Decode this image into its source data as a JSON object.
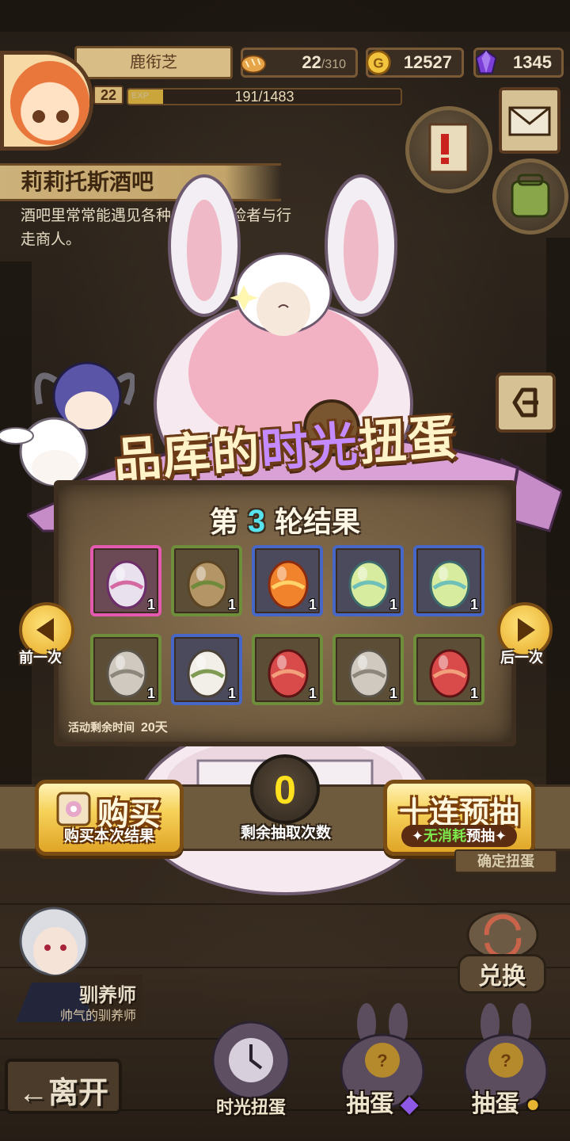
{
  "player": {
    "name": "鹿衔芝",
    "level": "22",
    "exp_label": "EXP",
    "exp_text": "191/1483",
    "exp_fraction": 0.1288
  },
  "resources": {
    "stamina": "22",
    "stamina_max": "/310",
    "gold": "12527",
    "gems": "1345"
  },
  "location": {
    "title": "莉莉托斯酒吧",
    "description": "酒吧里常常能遇见各种各样的冒险者与行走商人。"
  },
  "banner": {
    "title_a": "品库的",
    "title_b": "时光",
    "title_c": "扭蛋"
  },
  "results": {
    "round_prefix": "第",
    "round_number": "3",
    "round_suffix": "轮结果",
    "remaining_time_label": "活动剩余时间",
    "remaining_time_value": "20天",
    "items": [
      {
        "icon": "dark-spider-egg-icon",
        "rarity": "pink",
        "qty": "1"
      },
      {
        "icon": "leaf-wrapped-egg-icon",
        "rarity": "green",
        "qty": "1"
      },
      {
        "icon": "flame-egg-icon",
        "rarity": "blue",
        "qty": "1"
      },
      {
        "icon": "serpent-egg-icon",
        "rarity": "blue",
        "qty": "1"
      },
      {
        "icon": "serpent-egg-icon",
        "rarity": "blue",
        "qty": "1"
      },
      {
        "icon": "grey-shell-egg-icon",
        "rarity": "green",
        "qty": "1"
      },
      {
        "icon": "skull-egg-icon",
        "rarity": "blue",
        "qty": "1"
      },
      {
        "icon": "red-rune-egg-icon",
        "rarity": "green",
        "qty": "1"
      },
      {
        "icon": "grey-shell-egg-icon",
        "rarity": "green",
        "qty": "1"
      },
      {
        "icon": "red-rune-egg-icon",
        "rarity": "green",
        "qty": "1"
      }
    ]
  },
  "nav": {
    "prev_label": "前一次",
    "next_label": "后一次"
  },
  "actions": {
    "buy_label": "购买",
    "buy_sub": "购买本次结果",
    "draws_left": "0",
    "draws_left_label": "剩余抽取次数",
    "preview_label": "十连预抽",
    "preview_free": "无消耗",
    "preview_sub": "预抽"
  },
  "tamer": {
    "name": "驯养师",
    "title": "帅气的驯养师"
  },
  "bottom": {
    "leave_label": "←离开",
    "timegacha_label": "时光扭蛋",
    "draw_gem_label": "抽蛋",
    "draw_gold_label": "抽蛋",
    "exchange_label": "兑换",
    "fixed_banner": "确定扭蛋"
  },
  "colors": {
    "rarity_pink": "#e45ab1",
    "rarity_blue": "#4666c8",
    "rarity_green": "#6f8e3b",
    "counter": "#ffe21d",
    "round_number": "#56e3ee"
  }
}
